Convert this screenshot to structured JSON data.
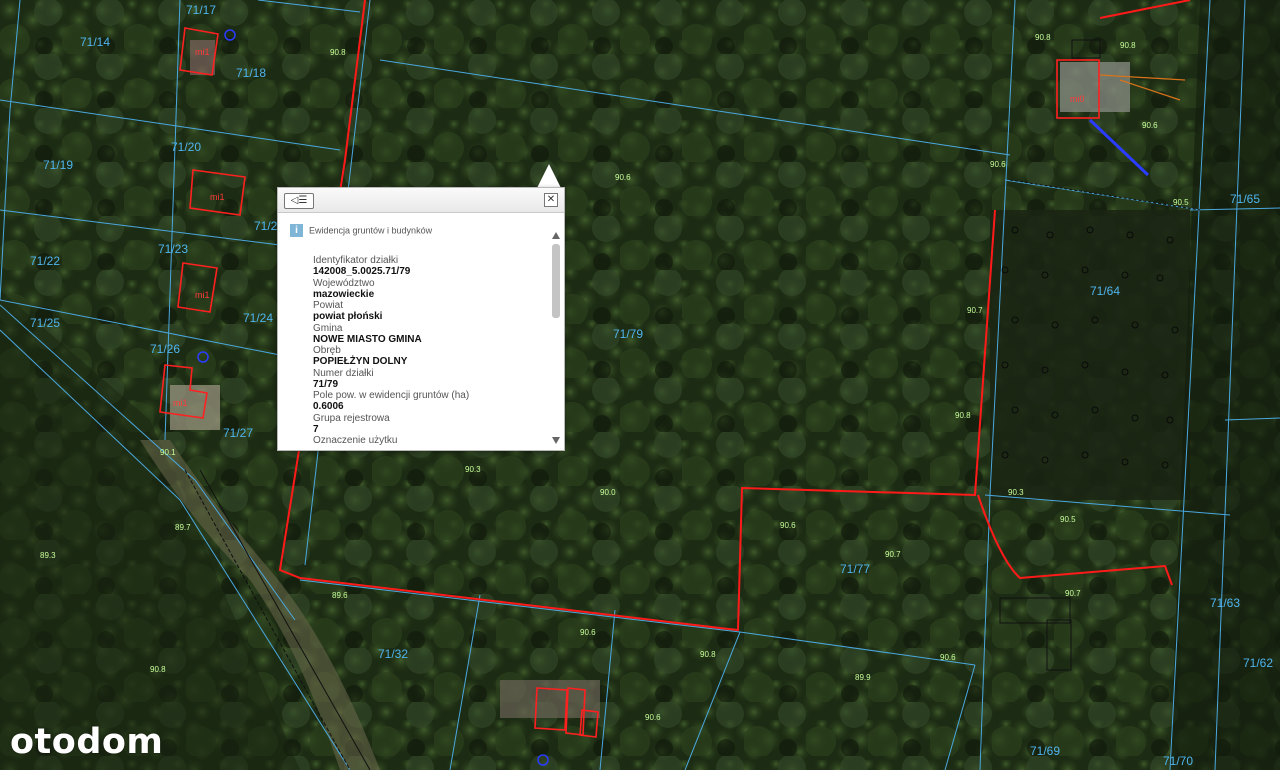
{
  "map": {
    "parcel_labels": [
      "71/17",
      "71/14",
      "71/18",
      "71/19",
      "71/20",
      "71/21",
      "71/22",
      "71/23",
      "71/24",
      "71/25",
      "71/26",
      "71/27",
      "71/79",
      "71/64",
      "71/65",
      "71/77",
      "71/32",
      "71/63",
      "71/62",
      "71/69",
      "71/70"
    ],
    "height_labels": [
      "90.8",
      "90.8",
      "90.8",
      "90.6",
      "90.6",
      "90.5",
      "90.6",
      "90.7",
      "90.8",
      "90.3",
      "90.0",
      "90.1",
      "89.7",
      "89.3",
      "89.6",
      "90.6",
      "90.7",
      "90.6",
      "90.8",
      "90.6",
      "90.5",
      "90.3",
      "90.7",
      "90.8",
      "89.9",
      "90.6"
    ],
    "building_labels": [
      "mi1",
      "mi1",
      "mi0",
      "mi1",
      "mi1"
    ],
    "colors": {
      "parcel": "#4aa8e0",
      "boundary": "#ff2020",
      "building": "#ff2020"
    }
  },
  "popup": {
    "layer_icon": "info-icon",
    "layer_title": "Ewidencja gruntów i budynków",
    "fields": [
      {
        "label": "Identyfikator działki",
        "value": "142008_5.0025.71/79"
      },
      {
        "label": "Województwo",
        "value": "mazowieckie"
      },
      {
        "label": "Powiat",
        "value": "powiat płoński"
      },
      {
        "label": "Gmina",
        "value": "NOWE MIASTO GMINA"
      },
      {
        "label": "Obręb",
        "value": "POPIEŁŻYN DOLNY"
      },
      {
        "label": "Numer działki",
        "value": "71/79"
      },
      {
        "label": "Pole pow. w ewidencji gruntów (ha)",
        "value": "0.6006"
      },
      {
        "label": "Grupa rejestrowa",
        "value": "7"
      },
      {
        "label": "Oznaczenie użytku",
        "value": ""
      }
    ]
  },
  "watermark": "otodom"
}
